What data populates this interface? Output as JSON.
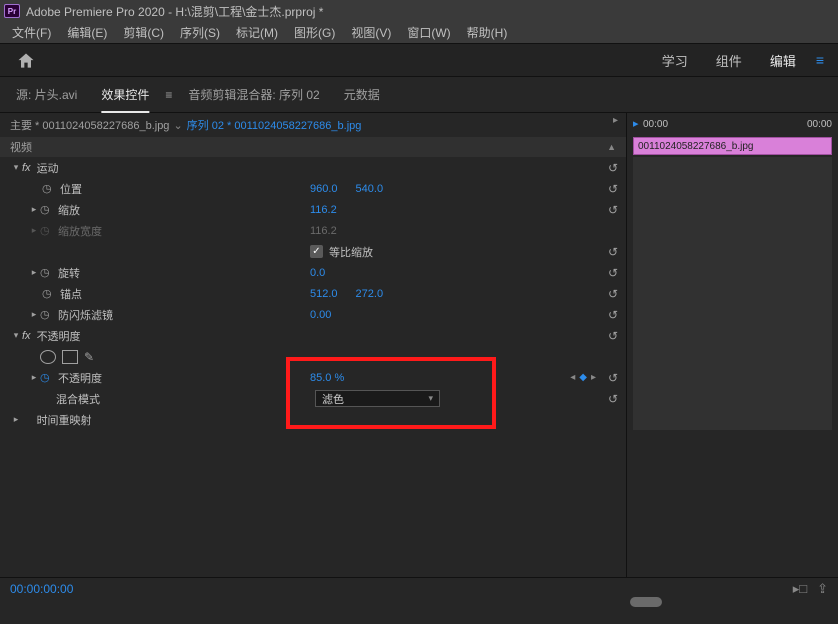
{
  "title": "Adobe Premiere Pro 2020 - H:\\混剪\\工程\\金士杰.prproj *",
  "logo": "Pr",
  "menu": [
    "文件(F)",
    "编辑(E)",
    "剪辑(C)",
    "序列(S)",
    "标记(M)",
    "图形(G)",
    "视图(V)",
    "窗口(W)",
    "帮助(H)"
  ],
  "topTabs": {
    "learn": "学习",
    "assembly": "组件",
    "edit": "编辑"
  },
  "panelTabs": {
    "source": "源: 片头.avi",
    "effects": "效果控件",
    "audio": "音频剪辑混合器: 序列 02",
    "metadata": "元数据"
  },
  "breadcrumb": {
    "master": "主要 * 0011024058227686_b.jpg",
    "seq": "序列 02 * 0011024058227686_b.jpg"
  },
  "props": {
    "videoHeader": "视频",
    "motion": "运动",
    "position": {
      "label": "位置",
      "x": "960.0",
      "y": "540.0"
    },
    "scale": {
      "label": "缩放",
      "v": "116.2"
    },
    "scaleWidth": {
      "label": "缩放宽度",
      "v": "116.2"
    },
    "uniform": {
      "label": "等比缩放"
    },
    "rotation": {
      "label": "旋转",
      "v": "0.0"
    },
    "anchor": {
      "label": "锚点",
      "x": "512.0",
      "y": "272.0"
    },
    "antiflicker": {
      "label": "防闪烁滤镜",
      "v": "0.00"
    },
    "opacitySection": "不透明度",
    "opacity": {
      "label": "不透明度",
      "v": "85.0 %"
    },
    "blend": {
      "label": "混合模式",
      "v": "滤色"
    },
    "timeRemap": "时间重映射"
  },
  "timeline": {
    "start": "00:00",
    "end": "00:00",
    "clip": "0011024058227686_b.jpg"
  },
  "timecode": "00:00:00:00"
}
